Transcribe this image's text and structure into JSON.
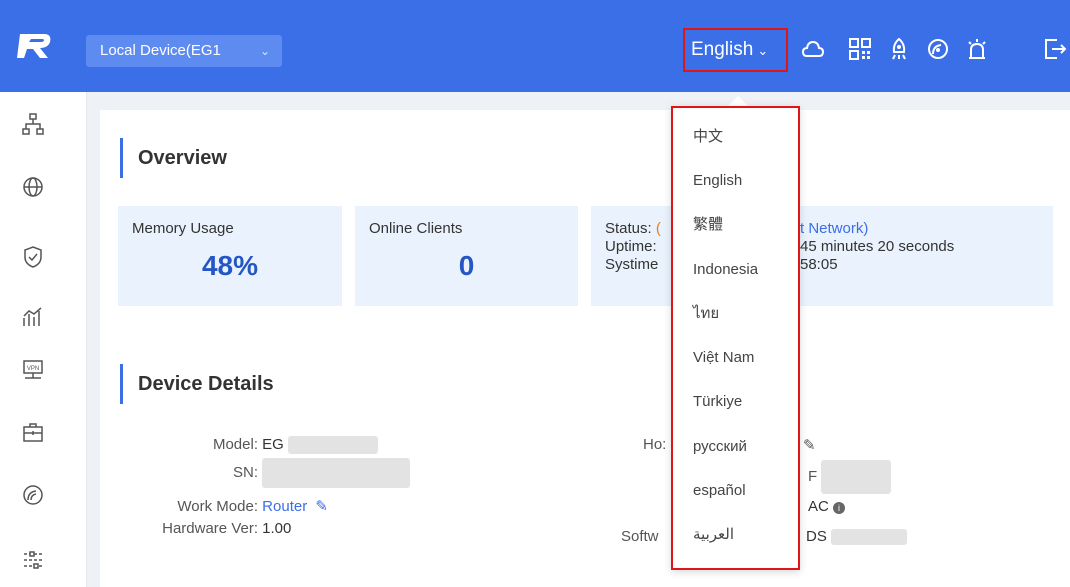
{
  "header": {
    "device_selector": "Local Device(EG1",
    "language_selector": "English"
  },
  "overview": {
    "title": "Overview",
    "memory_label": "Memory Usage",
    "memory_value": "48%",
    "clients_label": "Online Clients",
    "clients_value": "0",
    "status_label": "Status:",
    "status_value": "(",
    "status_value_cont": "t Network)",
    "uptime_label": "Uptime:",
    "uptime_value": "45 minutes 20 seconds",
    "systime_label": "Systime",
    "systime_value": "58:05"
  },
  "details": {
    "title": "Device Details",
    "model_label": "Model:",
    "model_value": "EG",
    "sn_label": "SN:",
    "workmode_label": "Work Mode:",
    "workmode_value": "Router",
    "hardware_label": "Hardware Ver:",
    "hardware_value": "1.00",
    "host_label": "Ho:",
    "right_line2": "F",
    "right_line3": "AC",
    "software_label": "Softw",
    "software_value": "DS"
  },
  "language_menu": [
    "中文",
    "English",
    "繁體",
    "Indonesia",
    "ไทย",
    "Việt Nam",
    "Türkiye",
    "русский",
    "español",
    "العربية"
  ],
  "colors": {
    "topbar": "#3a6fe8",
    "highlight": "#e01515",
    "accent": "#2457c5"
  }
}
